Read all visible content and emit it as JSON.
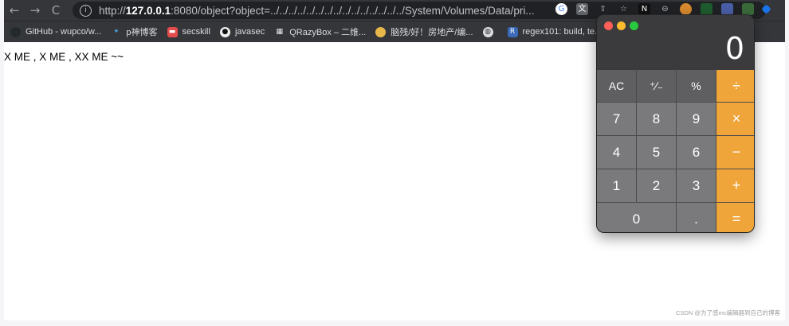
{
  "browser": {
    "nav": {
      "back": "←",
      "forward": "→",
      "reload": "C"
    },
    "url_prefix": "http://",
    "url_host": "127.0.0.1",
    "url_rest": ":8080/object?object=../../../../../../../../../../../../../../../System/Volumes/Data/pri...",
    "info_glyph": "i",
    "bookmarks": [
      {
        "label": "GitHub - wupco/w...",
        "icon": "github-icon",
        "color": "#24292e"
      },
      {
        "label": "p神博客",
        "icon": "blog-icon",
        "color": "#4a9ee0"
      },
      {
        "label": "secskill",
        "icon": "secskill-icon",
        "color": "#e34b4b"
      },
      {
        "label": "javasec",
        "icon": "github-icon",
        "color": "#f0f0f0"
      },
      {
        "label": "QRazyBox – 二维...",
        "icon": "qr-icon",
        "color": "#f0f0f0"
      },
      {
        "label": "脑残/好！房地产/编...",
        "icon": "brain-icon",
        "color": "#e6b84a"
      },
      {
        "label": "",
        "icon": "globe-icon",
        "color": "#dadce0"
      },
      {
        "label": "regex101: build, te...",
        "icon": "regex-icon",
        "color": "#3a6ab8"
      }
    ]
  },
  "page": {
    "text": "X ME , X ME , XX ME ~~",
    "watermark": "CSDN @为了感mc编辑器到自己的博客"
  },
  "calculator": {
    "display": "0",
    "lights": {
      "close": "#ff5f57",
      "minimize": "#febc2e",
      "zoom": "#28c840"
    },
    "keys": [
      {
        "label": "AC",
        "kind": "fn",
        "name": "clear-button"
      },
      {
        "label": "⁺∕₋",
        "kind": "fn",
        "name": "sign-toggle-button"
      },
      {
        "label": "%",
        "kind": "fn",
        "name": "percent-button"
      },
      {
        "label": "÷",
        "kind": "op",
        "name": "divide-button"
      },
      {
        "label": "7",
        "kind": "num",
        "name": "digit-7-button"
      },
      {
        "label": "8",
        "kind": "num",
        "name": "digit-8-button"
      },
      {
        "label": "9",
        "kind": "num",
        "name": "digit-9-button"
      },
      {
        "label": "×",
        "kind": "op",
        "name": "multiply-button"
      },
      {
        "label": "4",
        "kind": "num",
        "name": "digit-4-button"
      },
      {
        "label": "5",
        "kind": "num",
        "name": "digit-5-button"
      },
      {
        "label": "6",
        "kind": "num",
        "name": "digit-6-button"
      },
      {
        "label": "−",
        "kind": "op",
        "name": "subtract-button"
      },
      {
        "label": "1",
        "kind": "num",
        "name": "digit-1-button"
      },
      {
        "label": "2",
        "kind": "num",
        "name": "digit-2-button"
      },
      {
        "label": "3",
        "kind": "num",
        "name": "digit-3-button"
      },
      {
        "label": "+",
        "kind": "op",
        "name": "add-button"
      },
      {
        "label": "0",
        "kind": "num zero",
        "name": "digit-0-button"
      },
      {
        "label": ".",
        "kind": "num",
        "name": "decimal-button"
      },
      {
        "label": "=",
        "kind": "op",
        "name": "equals-button"
      }
    ]
  }
}
